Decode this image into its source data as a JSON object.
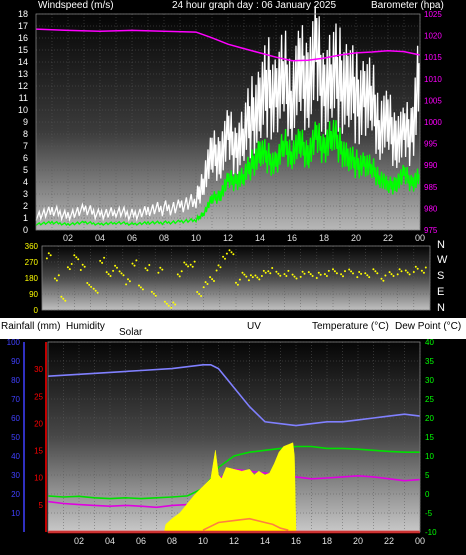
{
  "header": {
    "windspeed_label": "Windspeed (m/s)",
    "title": "24 hour graph day : 06 January 2025",
    "barometer_label": "Barometer (hpa)"
  },
  "lower_header": {
    "rainfall_label": "Rainfall (mm)",
    "humidity_label": "Humidity",
    "solar_label": "Solar",
    "uv_label": "UV",
    "temperature_label": "Temperature (°C)",
    "dewpoint_label": "Dew Point (°C)"
  },
  "compass": [
    "N",
    "W",
    "S",
    "E",
    "N"
  ],
  "colors": {
    "wind_gust": "#ffffff",
    "wind_avg": "#00ff00",
    "barometer": "#ff00ff",
    "direction": "#ffff00",
    "humidity": "#8080ff",
    "temperature": "#00e000",
    "dewpoint": "#e000e0",
    "solar": "#ffff00",
    "uv": "#ff8040",
    "rain": "#ff0000",
    "rain_axis": "#ff0000",
    "humidity_axis": "#4040ff",
    "temp_axis": "#00ff00"
  },
  "chart_data": [
    {
      "type": "line",
      "name": "wind-barometer",
      "x_ticks": [
        "02",
        "04",
        "06",
        "08",
        "10",
        "12",
        "14",
        "16",
        "18",
        "20",
        "22",
        "00"
      ],
      "xlim": [
        0,
        24
      ],
      "ylim_left": [
        0,
        18
      ],
      "y_ticks_left": [
        "0",
        "1",
        "2",
        "3",
        "4",
        "5",
        "6",
        "7",
        "8",
        "9",
        "10",
        "11",
        "12",
        "13",
        "14",
        "15",
        "16",
        "17",
        "18"
      ],
      "ylim_right": [
        975,
        1025
      ],
      "y_ticks_right": [
        "975",
        "980",
        "985",
        "990",
        "995",
        "1000",
        "1005",
        "1010",
        "1015",
        "1020",
        "1025"
      ],
      "series": [
        {
          "key": "gust",
          "axis": "left",
          "x": [
            0,
            1,
            2,
            3,
            4,
            5,
            6,
            7,
            8,
            9,
            10,
            10.5,
            11,
            11.5,
            12,
            12.5,
            13,
            13.5,
            14,
            14.5,
            15,
            15.5,
            16,
            16.5,
            17,
            17.5,
            18,
            18.5,
            19,
            19.5,
            20,
            20.5,
            21,
            21.5,
            22,
            22.5,
            23,
            23.5,
            24
          ],
          "values": [
            1.2,
            1.5,
            1.3,
            1.6,
            1.4,
            1.5,
            1.3,
            1.6,
            1.8,
            2.0,
            2.3,
            4.5,
            6.0,
            6.5,
            7.5,
            7.0,
            8.0,
            9.5,
            10.5,
            12.0,
            11.0,
            12.5,
            11.5,
            12.5,
            13.0,
            14.0,
            12.0,
            13.0,
            12.5,
            12.0,
            11.0,
            11.0,
            10.5,
            9.0,
            8.5,
            8.0,
            7.5,
            8.5,
            13.5
          ]
        },
        {
          "key": "avg",
          "axis": "left",
          "x": [
            0,
            1,
            2,
            3,
            4,
            5,
            6,
            7,
            8,
            9,
            10,
            10.5,
            11,
            11.5,
            12,
            12.5,
            13,
            13.5,
            14,
            14.5,
            15,
            15.5,
            16,
            16.5,
            17,
            17.5,
            18,
            18.5,
            19,
            19.5,
            20,
            20.5,
            21,
            21.5,
            22,
            22.5,
            23,
            23.5,
            24
          ],
          "values": [
            0.5,
            0.6,
            0.5,
            0.6,
            0.5,
            0.6,
            0.5,
            0.6,
            0.6,
            0.7,
            0.8,
            1.5,
            2.5,
            3.0,
            4.0,
            4.2,
            4.5,
            5.5,
            6.5,
            6.0,
            5.5,
            7.0,
            6.5,
            7.0,
            6.5,
            7.5,
            7.0,
            8.0,
            7.0,
            6.0,
            5.5,
            5.5,
            5.0,
            4.5,
            3.5,
            4.0,
            4.5,
            4.0,
            4.5
          ]
        },
        {
          "key": "baro",
          "axis": "right",
          "x": [
            0,
            2,
            4,
            6,
            8,
            10,
            11,
            12,
            13,
            14,
            15,
            16,
            17,
            18,
            19,
            20,
            21,
            22,
            23,
            24
          ],
          "values": [
            1021.5,
            1021.2,
            1021.0,
            1021.2,
            1021.0,
            1020.8,
            1019.5,
            1018.0,
            1017.0,
            1016.0,
            1015.0,
            1014.2,
            1014.3,
            1014.8,
            1015.5,
            1016.0,
            1016.2,
            1016.5,
            1016.3,
            1015.5
          ]
        }
      ]
    },
    {
      "type": "scatter",
      "name": "wind-direction",
      "x_ticks": [
        "02",
        "04",
        "06",
        "08",
        "10",
        "12",
        "14",
        "16",
        "18",
        "20",
        "22",
        "00"
      ],
      "xlim": [
        0,
        24
      ],
      "ylim": [
        0,
        360
      ],
      "y_ticks": [
        "0",
        "90",
        "180",
        "270",
        "360"
      ],
      "x": [
        0.3,
        0.8,
        1.2,
        1.6,
        2.0,
        2.4,
        2.8,
        3.2,
        3.6,
        4.0,
        4.4,
        4.8,
        5.2,
        5.6,
        6.0,
        6.4,
        6.8,
        7.2,
        7.6,
        8.0,
        8.4,
        8.8,
        9.2,
        9.6,
        10.0,
        10.4,
        10.8,
        11.2,
        11.6,
        12.0,
        12.4,
        12.8,
        13.2,
        13.6,
        14.0,
        14.5,
        15.0,
        15.5,
        16.0,
        16.5,
        17.0,
        17.5,
        18.0,
        18.5,
        19.0,
        19.5,
        20.0,
        20.5,
        21.0,
        21.5,
        22.0,
        22.5,
        23.0,
        23.5
      ],
      "values": [
        310,
        180,
        60,
        250,
        300,
        240,
        150,
        100,
        280,
        200,
        230,
        210,
        160,
        260,
        120,
        240,
        90,
        220,
        40,
        30,
        200,
        250,
        260,
        90,
        140,
        180,
        240,
        300,
        320,
        160,
        200,
        180,
        190,
        210,
        220,
        200,
        210,
        190,
        200,
        210,
        200,
        205,
        215,
        210,
        220,
        200,
        205,
        210,
        180,
        200,
        210,
        215,
        230,
        220
      ]
    },
    {
      "type": "line",
      "name": "temp-humidity-solar",
      "x_ticks": [
        "02",
        "04",
        "06",
        "08",
        "10",
        "12",
        "14",
        "16",
        "18",
        "20",
        "22",
        "00"
      ],
      "xlim": [
        0,
        24
      ],
      "humidity_ticks": [
        "10",
        "20",
        "30",
        "40",
        "50",
        "60",
        "70",
        "80",
        "90",
        "100"
      ],
      "humidity_range": [
        0,
        100
      ],
      "rain_ticks": [
        "5",
        "10",
        "15",
        "20",
        "25",
        "30"
      ],
      "rain_range": [
        0,
        35
      ],
      "temp_ticks": [
        "-10",
        "-5",
        "0",
        "5",
        "10",
        "15",
        "20",
        "25",
        "30",
        "35",
        "40"
      ],
      "temp_range": [
        -10,
        40
      ],
      "series": [
        {
          "key": "humidity",
          "axis": "humidity",
          "x": [
            0,
            2,
            4,
            6,
            8,
            9,
            10,
            10.5,
            11,
            12,
            13,
            14,
            15,
            16,
            17,
            18,
            19,
            20,
            21,
            22,
            23,
            24
          ],
          "values": [
            82,
            83,
            84,
            85,
            86,
            87,
            88,
            88,
            86,
            76,
            66,
            58,
            57,
            56,
            57,
            58,
            58,
            59,
            60,
            61,
            62,
            61
          ]
        },
        {
          "key": "temperature",
          "axis": "temp",
          "x": [
            0,
            1,
            2,
            3,
            4,
            5,
            6,
            7,
            8,
            9,
            10,
            10.5,
            11,
            12,
            13,
            14,
            15,
            16,
            17,
            18,
            19,
            20,
            21,
            22,
            23,
            24
          ],
          "values": [
            -0.5,
            -0.8,
            -0.6,
            -1.0,
            -1.2,
            -1.0,
            -1.2,
            -1.0,
            -0.8,
            -0.5,
            1.5,
            4.0,
            7.0,
            10.0,
            11.0,
            11.5,
            12.0,
            12.5,
            12.5,
            12.0,
            12.0,
            11.8,
            11.5,
            11.2,
            11.0,
            11.0
          ]
        },
        {
          "key": "dewpoint",
          "axis": "temp",
          "x": [
            0,
            1,
            2,
            3,
            4,
            5,
            6,
            7,
            8,
            9,
            10,
            10.5,
            11,
            12,
            13,
            14,
            15,
            16,
            17,
            18,
            19,
            20,
            21,
            22,
            23,
            24
          ],
          "values": [
            -2.0,
            -2.5,
            -2.8,
            -3.0,
            -3.2,
            -3.0,
            -3.2,
            -3.5,
            -3.0,
            -2.8,
            -1.5,
            1.0,
            4.0,
            6.5,
            6.0,
            5.5,
            5.0,
            4.5,
            4.0,
            4.2,
            4.5,
            4.8,
            4.5,
            4.0,
            3.5,
            3.8
          ]
        },
        {
          "key": "solar",
          "axis": "humidity",
          "x": [
            7.5,
            7.6,
            8,
            8.5,
            9,
            9.5,
            10,
            10.5,
            10.8,
            11,
            11.2,
            11.5,
            12,
            12.5,
            13,
            13.3,
            13.6,
            14,
            14.3,
            14.6,
            14.9,
            15.2,
            15.5,
            15.8,
            15.9,
            16.0
          ],
          "values": [
            0,
            4,
            7,
            10,
            15,
            20,
            24,
            28,
            43,
            30,
            28,
            34,
            33,
            32,
            33,
            30,
            32,
            30,
            31,
            36,
            42,
            45,
            46,
            47,
            40,
            0
          ]
        },
        {
          "key": "uv",
          "axis": "humidity",
          "x": [
            10,
            10.5,
            11,
            12,
            13,
            14,
            14.5,
            15,
            15.5
          ],
          "values": [
            1,
            3,
            5,
            6,
            7,
            5,
            4,
            2,
            1
          ]
        },
        {
          "key": "rain",
          "axis": "rain",
          "x": [
            0,
            24
          ],
          "values": [
            0,
            0
          ]
        }
      ]
    }
  ]
}
